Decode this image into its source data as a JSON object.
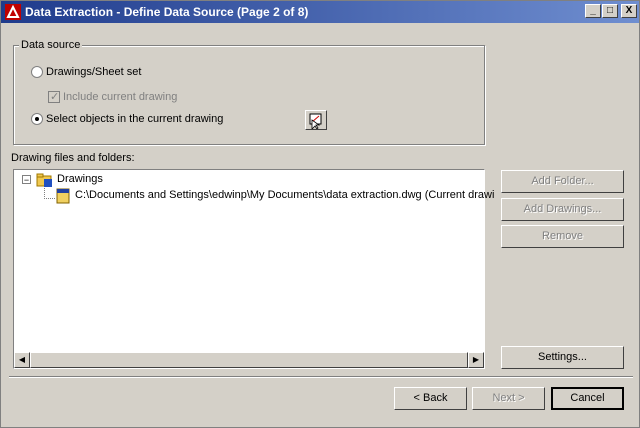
{
  "window": {
    "title": "Data Extraction - Define Data Source (Page 2 of 8)",
    "controls": {
      "minimize": "_",
      "restore": "□",
      "close": "X"
    }
  },
  "data_source": {
    "group_label": "Data source",
    "option_drawings": {
      "label": "Drawings/Sheet set",
      "selected": false
    },
    "include_current": {
      "label": "Include current drawing",
      "checked": true,
      "enabled": false
    },
    "option_select": {
      "label": "Select objects in the current drawing",
      "selected": true
    }
  },
  "files": {
    "label": "Drawing files and folders:",
    "tree": {
      "root": "Drawings",
      "children": [
        "C:\\Documents and Settings\\edwinp\\My Documents\\data extraction.dwg (Current drawi"
      ]
    }
  },
  "side_buttons": {
    "add_folder": "Add Folder...",
    "add_drawings": "Add Drawings...",
    "remove": "Remove",
    "settings": "Settings..."
  },
  "nav": {
    "back": "< Back",
    "next": "Next >",
    "cancel": "Cancel"
  }
}
